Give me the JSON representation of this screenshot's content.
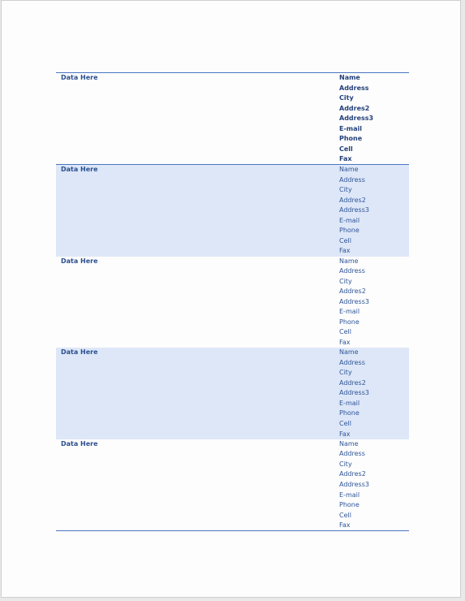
{
  "rows": [
    {
      "label": "Data Here",
      "fields": [
        "Name",
        "Address",
        "City",
        "Addres2",
        "Address3",
        "E-mail",
        "Phone",
        "Cell",
        "Fax"
      ]
    },
    {
      "label": "Data Here",
      "fields": [
        "Name",
        "Address",
        "City",
        "Addres2",
        "Address3",
        "E-mail",
        "Phone",
        "Cell",
        "Fax"
      ]
    },
    {
      "label": "Data Here",
      "fields": [
        "Name",
        "Address",
        "City",
        "Addres2",
        "Address3",
        "E-mail",
        "Phone",
        "Cell",
        "Fax"
      ]
    },
    {
      "label": "Data Here",
      "fields": [
        "Name",
        "Address",
        "City",
        "Addres2",
        "Address3",
        "E-mail",
        "Phone",
        "Cell",
        "Fax"
      ]
    },
    {
      "label": "Data Here",
      "fields": [
        "Name",
        "Address",
        "City",
        "Addres2",
        "Address3",
        "E-mail",
        "Phone",
        "Cell",
        "Fax"
      ]
    }
  ],
  "colors": {
    "rule": "#4a76c0",
    "band": "#dde7f8",
    "header_text": "#24417a",
    "text": "#2f5597"
  }
}
